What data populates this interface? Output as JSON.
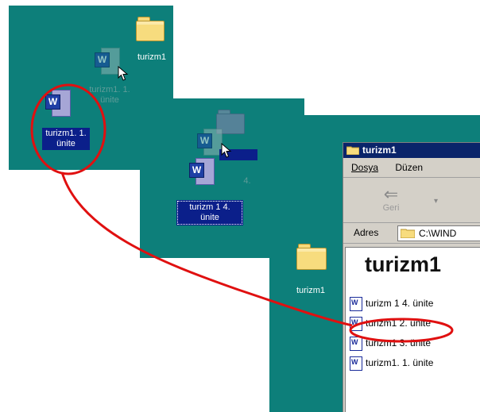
{
  "panel1": {
    "folder_label": "turizm1",
    "ghost_label_line1": "turizm1. 1.",
    "ghost_label_line2": "ünite",
    "selected_label_line1": "turizm1. 1.",
    "selected_label_line2": "ünite"
  },
  "panel2": {
    "ghost_label": "4.",
    "selected_label_line1": "turizm 1 4.",
    "selected_label_line2": "ünite"
  },
  "panel3": {
    "folder_label": "turizm1",
    "window": {
      "title": "turizm1",
      "menu": [
        "Dosya",
        "Düzen"
      ],
      "back_label": "Geri",
      "address_label": "Adres",
      "address_value": "C:\\WIND",
      "content_title": "turizm1",
      "files": [
        "turizm 1 4. ünite",
        "turizm1 2. ünite",
        "turizm1 3. ünite",
        "turizm1. 1. ünite"
      ]
    }
  },
  "colors": {
    "desktop": "#0d7f7a",
    "selection": "#0b1f8a",
    "annotation": "#e01010"
  },
  "icons": [
    "folder-icon",
    "word-document-icon",
    "mouse-cursor-icon",
    "back-arrow-icon"
  ]
}
